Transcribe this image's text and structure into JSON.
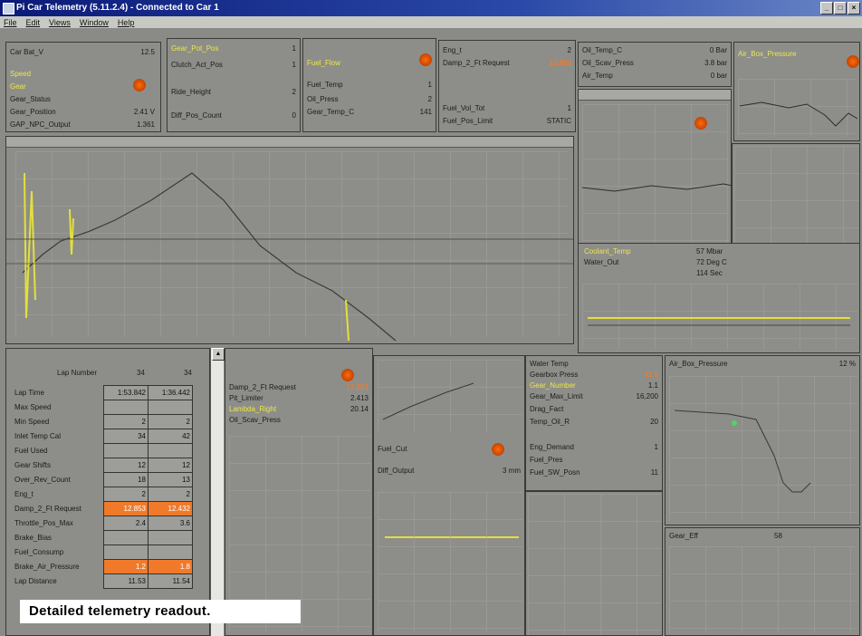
{
  "window": {
    "title": "Pi Car Telemetry (5.11.2.4) - Connected to Car 1"
  },
  "menu": [
    "File",
    "Edit",
    "Views",
    "Window",
    "Help"
  ],
  "caption": "Detailed telemetry readout.",
  "colors": {
    "title_bar": "#0b1a78",
    "highlight_orange": "#f07a2a",
    "highlight_yellow": "#ece64a",
    "panel_bg": "#8d8e89"
  },
  "panels": {
    "top_left": {
      "rows": [
        {
          "label": "Car Bat_V",
          "value": "12.5"
        },
        {
          "label": "Speed",
          "value": ""
        },
        {
          "label": "Gear",
          "value": ""
        },
        {
          "label": "Gear_Status",
          "value": ""
        },
        {
          "label": "Gear_Position",
          "value": "2.41 V"
        },
        {
          "label": "GAP_NPC_Output",
          "value": "1.361"
        }
      ]
    },
    "top_mid1": {
      "rows": [
        {
          "label": "Gear_Pot_Pos",
          "value": "1"
        },
        {
          "label": "Clutch_Act_Pos",
          "value": "1"
        },
        {
          "label": "Ride_Height",
          "value": "2"
        },
        {
          "label": "Diff_Pos_Count",
          "value": "0"
        }
      ]
    },
    "top_mid2": {
      "rows": [
        {
          "label": "Fuel_Flow",
          "value": ""
        },
        {
          "label": "Fuel_Temp",
          "value": "1"
        },
        {
          "label": "Oil_Press",
          "value": "2"
        },
        {
          "label": "Gear_Temp_C",
          "value": "141"
        }
      ]
    },
    "top_mid3": {
      "rows": [
        {
          "label": "Eng_t",
          "value": "2"
        },
        {
          "label": "Damp_2_Ft Request",
          "value": "12.853"
        },
        {
          "label": "Fuel_Vol_Tot",
          "value": "1"
        },
        {
          "label": "Fuel_Pos_Limit",
          "value": "STATIC"
        }
      ]
    },
    "top_right": {
      "rows": [
        {
          "label": "Oil_Temp_C",
          "value": "0 Bar"
        },
        {
          "label": "Oil_Scav_Press",
          "value": "3.8 bar"
        },
        {
          "label": "Air_Temp",
          "value": "0 bar"
        },
        {
          "label": "Air_Box_Pressure",
          "value": ""
        }
      ]
    },
    "mid_right": {
      "rows": [
        {
          "label": "Coolant_Temp",
          "value": "57 Mbar"
        },
        {
          "label": "Water_Out",
          "value": "72 Deg C"
        },
        {
          "label": "",
          "value": "114 Sec"
        }
      ]
    },
    "lap_table": {
      "headers": {
        "label": "Lap Number",
        "c1": "34",
        "c2": "34"
      },
      "rows": [
        {
          "label": "Lap Time",
          "c1": "1:53.842",
          "c2": "1:36.442",
          "orange": false
        },
        {
          "label": "Max Speed",
          "c1": "",
          "c2": "",
          "orange": false
        },
        {
          "label": "Min Speed",
          "c1": "2",
          "c2": "2",
          "orange": false
        },
        {
          "label": "Inlet Temp Cal",
          "c1": "34",
          "c2": "42",
          "orange": false
        },
        {
          "label": "Fuel Used",
          "c1": "",
          "c2": "",
          "orange": false
        },
        {
          "label": "Gear Shifts",
          "c1": "12",
          "c2": "12",
          "orange": false
        },
        {
          "label": "Over_Rev_Count",
          "c1": "18",
          "c2": "13",
          "orange": false
        },
        {
          "label": "Eng_t",
          "c1": "2",
          "c2": "2",
          "orange": false
        },
        {
          "label": "Damp_2_Ft Request",
          "c1": "12.853",
          "c2": "12.432",
          "orange": true
        },
        {
          "label": "Throttle_Pos_Max",
          "c1": "2.4",
          "c2": "3.6",
          "orange": false
        },
        {
          "label": "Brake_Bias",
          "c1": "",
          "c2": "",
          "orange": false
        },
        {
          "label": "Fuel_Consump",
          "c1": "",
          "c2": "",
          "orange": false
        },
        {
          "label": "Brake_Air_Pressure",
          "c1": "1.2",
          "c2": "1.8",
          "orange": true
        },
        {
          "label": "Lap Distance",
          "c1": "11.53",
          "c2": "11.54",
          "orange": false
        }
      ]
    },
    "bottom_mid1": {
      "rows": [
        {
          "label": "Damp_2_Ft Request",
          "value": "12.853"
        },
        {
          "label": "Pit_Limiter",
          "value": "2.413"
        },
        {
          "label": "Lambda_Right",
          "value": "20.14"
        },
        {
          "label": "Oil_Scav_Press",
          "value": ""
        }
      ]
    },
    "bottom_mid2": {
      "rows": [
        {
          "label": "Fuel_Cut",
          "value": ""
        },
        {
          "label": "Diff_Output",
          "value": "3 mm"
        }
      ]
    },
    "bottom_mid3": {
      "rows": [
        {
          "label": "Water Temp",
          "value": ""
        },
        {
          "label": "Gearbox Press",
          "value": "11.5"
        },
        {
          "label": "Gear_Number",
          "value": "1.1"
        },
        {
          "label": "Gear_Max_Limit",
          "value": "16,200"
        },
        {
          "label": "Drag_Fact",
          "value": ""
        },
        {
          "label": "Temp_Oil_R",
          "value": "20"
        },
        {
          "label": "Eng_Demand",
          "value": "1"
        },
        {
          "label": "Fuel_Pres",
          "value": ""
        },
        {
          "label": "Fuel_SW_Posn",
          "value": "11"
        }
      ]
    },
    "bottom_right": {
      "rows": [
        {
          "label": "Air_Box_Pressure",
          "value": "12 %"
        },
        {
          "label": "Gear_Eff",
          "value": "58"
        }
      ]
    }
  }
}
